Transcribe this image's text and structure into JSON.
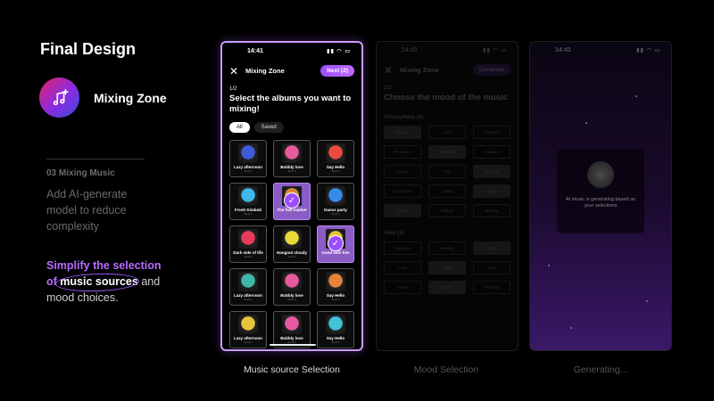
{
  "page": {
    "title": "Final Design",
    "app_name": "Mixing Zone",
    "step": "03 Mixing Music",
    "description": "Add AI-generate model to reduce complexity",
    "highlight_prefix": "Simplify the selection",
    "highlight_of": "of",
    "highlight_circled": "music sources",
    "highlight_and": "and",
    "highlight_rest": "mood choices."
  },
  "phone1": {
    "time": "14:41",
    "nav_title": "Mixing Zone",
    "next_label": "Next (2)",
    "step_num": "1/2",
    "heading": "Select the albums you want to mixing!",
    "filters": [
      "All",
      "Saved"
    ],
    "albums": [
      {
        "name": "Lazy afternoon",
        "sub": "Sunli 4",
        "selected": false,
        "art": "#3f5bd8"
      },
      {
        "name": "Bubbly love",
        "sub": "Sunli 4",
        "selected": false,
        "art": "#e85aa0"
      },
      {
        "name": "Say Hello",
        "sub": "Sunli 4",
        "selected": false,
        "art": "#e84b3c"
      },
      {
        "name": "Fresh Kimbob",
        "sub": "Sunli 4",
        "selected": false,
        "art": "#3fb7e8"
      },
      {
        "name": "The fish market",
        "sub": "Sunli 4",
        "selected": true,
        "art": "#d88a3a"
      },
      {
        "name": "Dance party",
        "sub": "Sunli 4",
        "selected": false,
        "art": "#3a8ae8"
      },
      {
        "name": "Dark side of life",
        "sub": "Sunli 4",
        "selected": false,
        "art": "#e83a5a"
      },
      {
        "name": "Hangout cloudy",
        "sub": "Sunli 4",
        "selected": false,
        "art": "#e8d83a"
      },
      {
        "name": "Good with him",
        "sub": "Sunli 4",
        "selected": true,
        "art": "#e8c43a"
      },
      {
        "name": "Lazy afternoon",
        "sub": "Sunli 4",
        "selected": false,
        "art": "#3fb7a8"
      },
      {
        "name": "Bubbly love",
        "sub": "Sunli 4",
        "selected": false,
        "art": "#e85aa0"
      },
      {
        "name": "Say Hello",
        "sub": "Sunli 4",
        "selected": false,
        "art": "#e8843a"
      },
      {
        "name": "Lazy afternoon",
        "sub": "Sunli 4",
        "selected": false,
        "art": "#e8c43a"
      },
      {
        "name": "Bubbly love",
        "sub": "Sunli 4",
        "selected": false,
        "art": "#e85aa0"
      },
      {
        "name": "Say Hello",
        "sub": "Sunli 4",
        "selected": false,
        "art": "#3fc4d8"
      }
    ]
  },
  "phone2": {
    "time": "14:41",
    "nav_title": "Mixing Zone",
    "next_label": "Generate",
    "step_num": "2/2",
    "heading": "Choose the mood of the music",
    "section1": "Atmosphere (6)",
    "tags1": [
      {
        "t": "Dreamy",
        "f": true
      },
      {
        "t": "Calm",
        "f": false
      },
      {
        "t": "Chaotic",
        "f": false
      },
      {
        "t": "Peaceful",
        "f": false
      },
      {
        "t": "Nostalgic",
        "f": true
      },
      {
        "t": "Classic",
        "f": false
      },
      {
        "t": "Funky",
        "f": false
      },
      {
        "t": "Pop",
        "f": false
      },
      {
        "t": "Groovy",
        "f": true
      },
      {
        "t": "Cinematic",
        "f": false
      },
      {
        "t": "Jazzy",
        "f": false
      },
      {
        "t": "Bright",
        "f": true
      },
      {
        "t": "Happy",
        "f": true
      },
      {
        "t": "Mellow",
        "f": false
      },
      {
        "t": "Intense",
        "f": false
      }
    ],
    "section2": "Vibe (3)",
    "tags2": [
      {
        "t": "Hang out",
        "f": false
      },
      {
        "t": "Healing",
        "f": false
      },
      {
        "t": "Party",
        "f": true
      },
      {
        "t": "Love",
        "f": false
      },
      {
        "t": "Chill",
        "f": true
      },
      {
        "t": "Late",
        "f": false
      },
      {
        "t": "Travel",
        "f": false
      },
      {
        "t": "Study",
        "f": true
      },
      {
        "t": "Workout",
        "f": false
      }
    ]
  },
  "phone3": {
    "time": "14:41",
    "gen_text": "AI music is generating based on your selections"
  },
  "captions": [
    "Music source Selection",
    "Mood Selection",
    "Generating..."
  ],
  "colors": {
    "accent": "#9b4dff",
    "selected_card": "#8a5cc6",
    "phone_border": "#c89cff"
  }
}
